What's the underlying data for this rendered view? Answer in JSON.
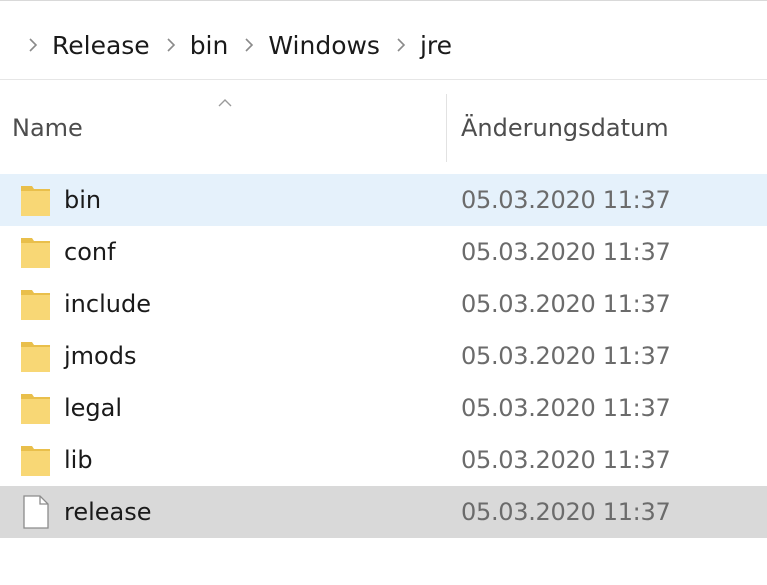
{
  "breadcrumb": {
    "items": [
      {
        "label": "Release"
      },
      {
        "label": "bin"
      },
      {
        "label": "Windows"
      },
      {
        "label": "jre"
      }
    ]
  },
  "columns": {
    "name": "Name",
    "date": "Änderungsdatum",
    "sort_icon": "chevron-up-icon"
  },
  "files": [
    {
      "name": "bin",
      "modified": "05.03.2020 11:37",
      "type": "folder",
      "state": "hover"
    },
    {
      "name": "conf",
      "modified": "05.03.2020 11:37",
      "type": "folder",
      "state": "normal"
    },
    {
      "name": "include",
      "modified": "05.03.2020 11:37",
      "type": "folder",
      "state": "normal"
    },
    {
      "name": "jmods",
      "modified": "05.03.2020 11:37",
      "type": "folder",
      "state": "normal"
    },
    {
      "name": "legal",
      "modified": "05.03.2020 11:37",
      "type": "folder",
      "state": "normal"
    },
    {
      "name": "lib",
      "modified": "05.03.2020 11:37",
      "type": "folder",
      "state": "normal"
    },
    {
      "name": "release",
      "modified": "05.03.2020 11:37",
      "type": "file",
      "state": "selected"
    }
  ],
  "colors": {
    "hover_row": "#e5f1fb",
    "selected_row": "#d9d9d9",
    "folder": "#f8d775",
    "folder_dark": "#e9bf4b"
  }
}
